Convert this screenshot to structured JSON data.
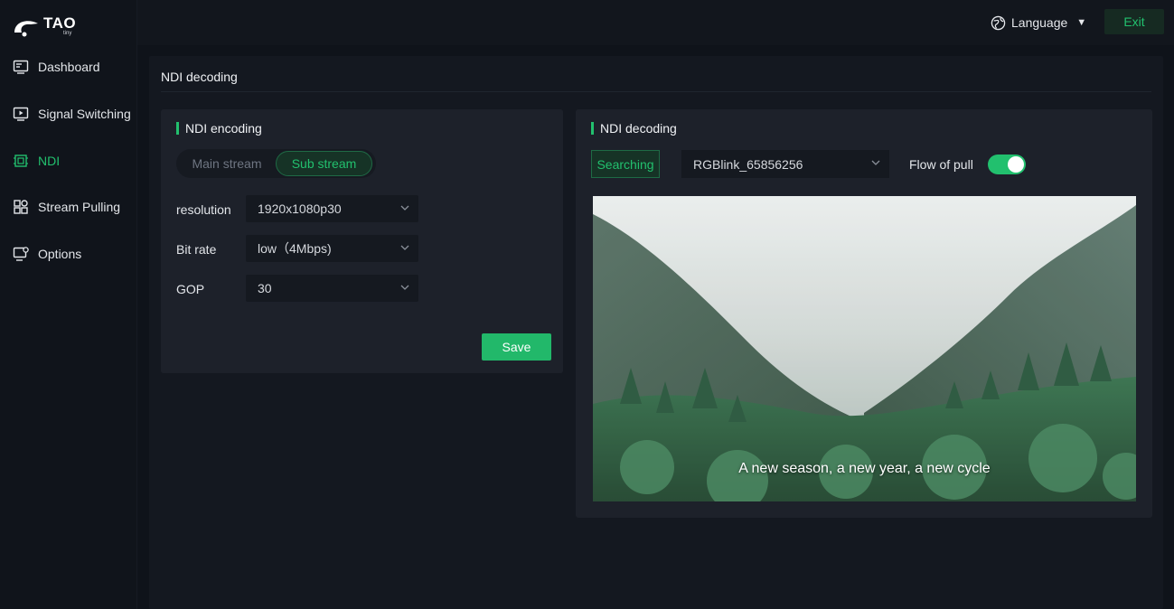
{
  "brand": {
    "name": "TAO",
    "sub": "tiny"
  },
  "sidebar": {
    "items": [
      {
        "label": "Dashboard",
        "icon": "dashboard-icon"
      },
      {
        "label": "Signal Switching",
        "icon": "monitor-play-icon"
      },
      {
        "label": "NDI",
        "icon": "ndi-icon",
        "active": true
      },
      {
        "label": "Stream Pulling",
        "icon": "grid-apps-icon"
      },
      {
        "label": "Options",
        "icon": "monitor-gear-icon"
      }
    ]
  },
  "topbar": {
    "language_label": "Language",
    "exit_label": "Exit"
  },
  "page": {
    "title": "NDI decoding"
  },
  "encoding": {
    "title": "NDI encoding",
    "tabs": {
      "main": "Main stream",
      "sub": "Sub stream",
      "active": "sub"
    },
    "fields": {
      "resolution": {
        "label": "resolution",
        "value": "1920x1080p30"
      },
      "bitrate": {
        "label": "Bit rate",
        "value": "low（4Mbps)"
      },
      "gop": {
        "label": "GOP",
        "value": "30"
      }
    },
    "save_label": "Save"
  },
  "decoding": {
    "title": "NDI decoding",
    "searching_label": "Searching",
    "source": "RGBlink_65856256",
    "flow_label": "Flow of pull",
    "flow_enabled": true,
    "caption": "A new season, a new year, a new cycle"
  },
  "colors": {
    "accent": "#22c06e",
    "background": "#0f131a",
    "card": "#1d212a"
  }
}
